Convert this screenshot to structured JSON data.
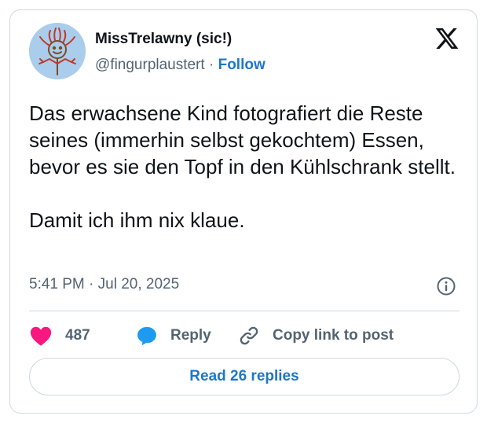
{
  "author": {
    "display_name": "MissTrelawny (sic!)",
    "handle": "@fingurplaustert",
    "separator": "·",
    "follow_label": "Follow",
    "avatar_icon": "doodle-face-icon"
  },
  "brand_icon": "x-logo-icon",
  "post": {
    "paragraphs": [
      "Das erwachsene Kind fotografiert die Reste seines (immerhin selbst gekochtem) Essen, bevor es sie den Topf in den Kühlschrank stellt.",
      "Damit ich ihm nix klaue."
    ],
    "time": "5:41 PM",
    "meta_separator": "·",
    "date": "Jul 20, 2025",
    "info_icon": "info-icon"
  },
  "actions": {
    "like_count": "487",
    "reply_label": "Reply",
    "copy_link_label": "Copy link to post"
  },
  "replies_button_label": "Read 26 replies",
  "colors": {
    "like": "#f91880",
    "reply": "#1d9bf0",
    "link": "#1d77c8",
    "muted": "#536471",
    "border": "#cfd9de"
  }
}
